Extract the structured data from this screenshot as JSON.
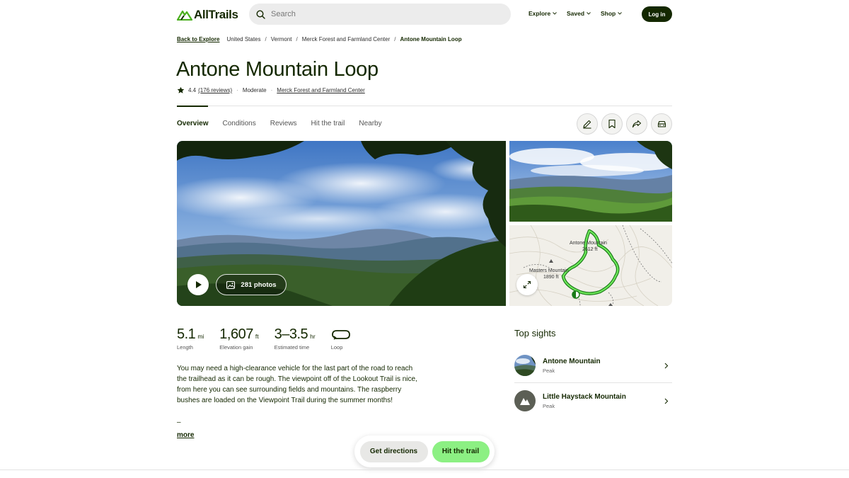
{
  "header": {
    "logo_text": "AllTrails",
    "search_placeholder": "Search",
    "nav": [
      {
        "label": "Explore"
      },
      {
        "label": "Saved"
      },
      {
        "label": "Shop"
      }
    ],
    "login_label": "Log in"
  },
  "breadcrumb": {
    "back": "Back to Explore",
    "items": [
      "United States",
      "Vermont",
      "Merck Forest and Farmland Center"
    ],
    "current": "Antone Mountain Loop"
  },
  "trail": {
    "title": "Antone Mountain Loop",
    "rating": "4.4",
    "reviews": "(176 reviews)",
    "difficulty": "Moderate",
    "park": "Merck Forest and Farmland Center",
    "rating_stars": 4.4
  },
  "tabs": [
    {
      "label": "Overview",
      "active": true
    },
    {
      "label": "Conditions"
    },
    {
      "label": "Reviews"
    },
    {
      "label": "Hit the trail"
    },
    {
      "label": "Nearby"
    }
  ],
  "gallery": {
    "photos_label": "281 photos",
    "map": {
      "peak1_name": "Antone Mountain",
      "peak1_elev": "2612 ft",
      "peak2_name": "Masters Mountain",
      "peak2_elev": "1890 ft"
    }
  },
  "stats": [
    {
      "value": "5.1",
      "unit": "mi",
      "label": "Length"
    },
    {
      "value": "1,607",
      "unit": "ft",
      "label": "Elevation gain"
    },
    {
      "value": "3–3.5",
      "unit": "hr",
      "label": "Estimated time"
    },
    {
      "value": "",
      "unit": "",
      "label": "Loop",
      "icon": "loop-icon"
    }
  ],
  "description": "You may need a high-clearance vehicle for the last part of the road to reach the trailhead as it can be rough. The viewpoint off of the Lookout Trail is nice, from here you can see surrounding fields and mountains. The raspberry bushes are loaded on the Viewpoint Trail during the summer months!",
  "description_dash": "–",
  "more_label": "more",
  "sights": {
    "heading": "Top sights",
    "items": [
      {
        "name": "Antone Mountain",
        "kind": "Peak"
      },
      {
        "name": "Little Haystack Mountain",
        "kind": "Peak"
      }
    ]
  },
  "bottom": {
    "directions_label": "Get directions",
    "hit_label": "Hit the trail"
  },
  "colors": {
    "brand_dark": "#142800",
    "accent_green": "#8cf083",
    "trail_green": "#2fb12c"
  }
}
